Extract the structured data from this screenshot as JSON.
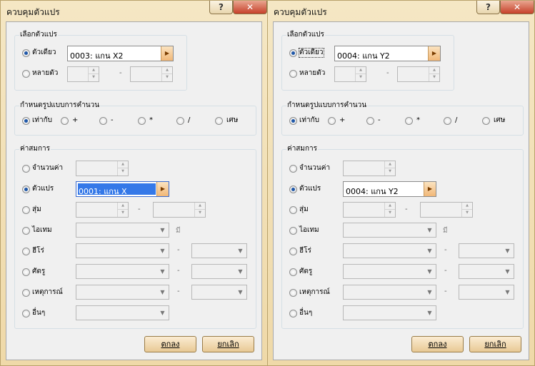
{
  "dialog_title": "ควบคุมตัวแปร",
  "help_symbol": "?",
  "close_symbol": "✕",
  "section_select": "เลือกตัวแปร",
  "opt_single": "ตัวเดียว",
  "opt_multiple": "หลายตัว",
  "section_operation": "กำหนดรูปแบบการคำนวน",
  "ops": [
    "เท่ากับ",
    "+",
    "-",
    "*",
    "/",
    "เศษ"
  ],
  "section_operand": "ค่าสมการ",
  "operand_opts": [
    "จำนวนค่า",
    "ตัวแปร",
    "สุ่ม",
    "ไอเทม",
    "ฮีโร่",
    "ศัตรู",
    "เหตุการณ์",
    "อื่นๆ"
  ],
  "item_suffix": "มี",
  "dash": "-",
  "ok_label": "ตกลง",
  "cancel_label": "ยกเลิก",
  "left": {
    "selected_var": "0003: แกน X2",
    "operand_var": "0001: แกน X"
  },
  "right": {
    "selected_var": "0004: แกน Y2",
    "operand_var": "0004: แกน Y2"
  }
}
